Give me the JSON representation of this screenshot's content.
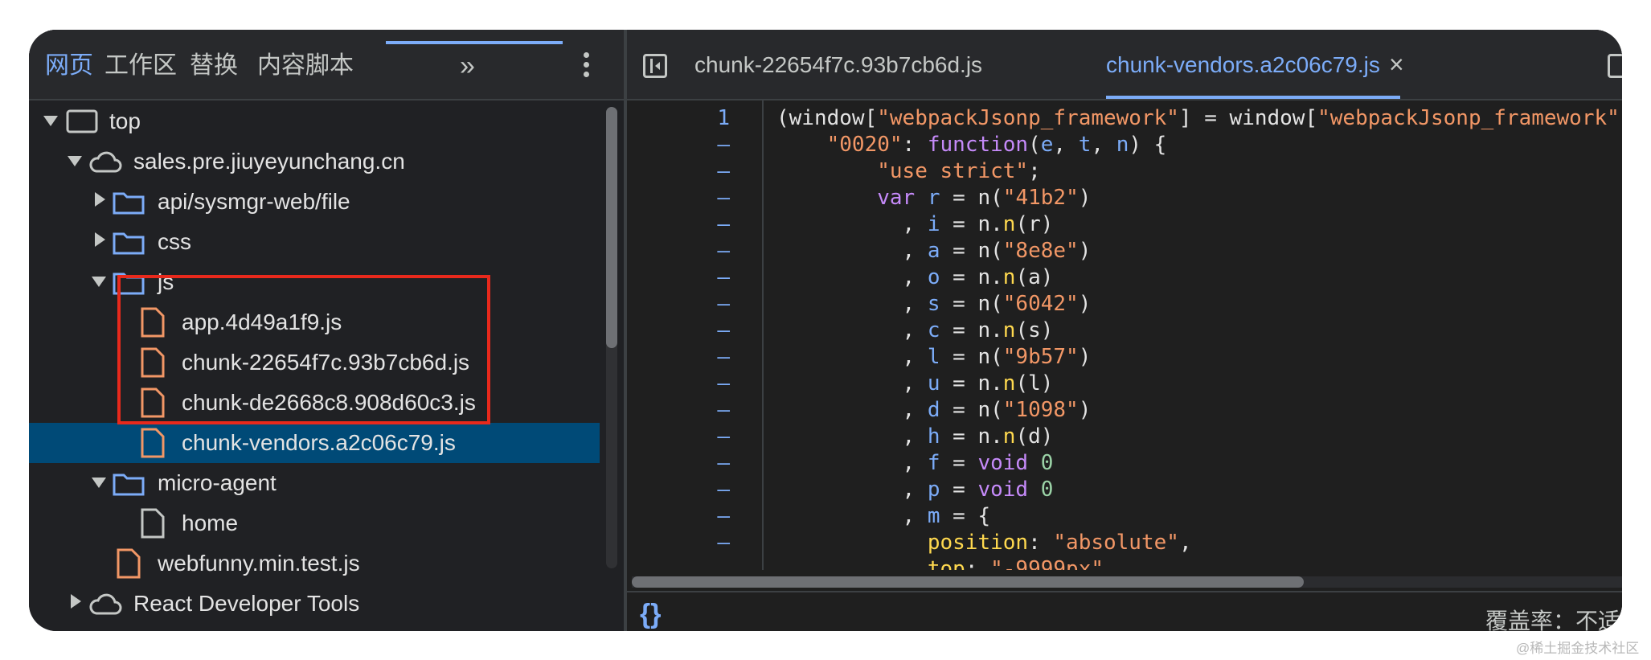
{
  "navigator": {
    "tabs": [
      {
        "label": "网页",
        "active": true
      },
      {
        "label": "工作区"
      },
      {
        "label": "替换"
      },
      {
        "label": "内容脚本"
      }
    ],
    "more_tabs": "»",
    "tree": [
      {
        "label": "top",
        "icon": "frame-icon",
        "expanded": true
      },
      {
        "label": "sales.pre.jiuyeyunchang.cn",
        "icon": "cloud-icon",
        "expanded": true
      },
      {
        "label": "api/sysmgr-web/file",
        "icon": "folder-icon",
        "expanded": false
      },
      {
        "label": "css",
        "icon": "folder-icon",
        "expanded": false
      },
      {
        "label": "js",
        "icon": "folder-icon",
        "expanded": true
      },
      {
        "label": "app.4d49a1f9.js",
        "icon": "js-file-icon"
      },
      {
        "label": "chunk-22654f7c.93b7cb6d.js",
        "icon": "js-file-icon"
      },
      {
        "label": "chunk-de2668c8.908d60c3.js",
        "icon": "js-file-icon"
      },
      {
        "label": "chunk-vendors.a2c06c79.js",
        "icon": "js-file-icon",
        "selected": true
      },
      {
        "label": "micro-agent",
        "icon": "folder-icon",
        "expanded": true
      },
      {
        "label": "home",
        "icon": "document-icon"
      },
      {
        "label": "webfunny.min.test.js",
        "icon": "js-file-icon"
      },
      {
        "label": "React Developer Tools",
        "icon": "cloud-icon",
        "expanded": false
      }
    ]
  },
  "editor": {
    "tabs": [
      {
        "label": "chunk-22654f7c.93b7cb6d.js"
      },
      {
        "label": "chunk-vendors.a2c06c79.js",
        "active": true
      }
    ],
    "close_glyph": "×",
    "gutter": [
      "1",
      "–",
      "–",
      "–",
      "–",
      "–",
      "–",
      "–",
      "–",
      "–",
      "–",
      "–",
      "–",
      "–",
      "–",
      "–",
      "–"
    ],
    "pretty_print": "{}",
    "coverage": "覆盖率：不适用"
  },
  "colors": {
    "accent": "#7cacf8",
    "selection": "#004a77",
    "highlight_box": "#e8291c",
    "string": "#f29766",
    "keyword": "#c58af9"
  },
  "watermark": "@稀土掘金技术社区"
}
